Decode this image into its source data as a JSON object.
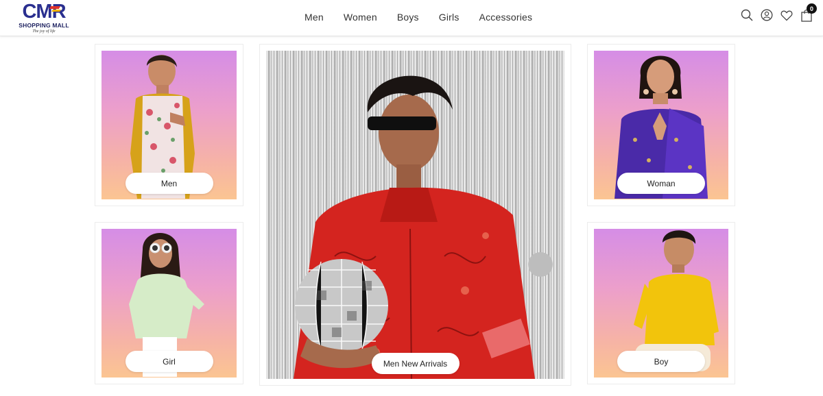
{
  "header": {
    "logo": {
      "mark": "CMR",
      "subtitle": "SHOPPING MALL",
      "tagline": "The joy of life"
    },
    "nav": [
      "Men",
      "Women",
      "Boys",
      "Girls",
      "Accessories"
    ],
    "icons": [
      "search-icon",
      "user-icon",
      "heart-icon",
      "cart-icon"
    ],
    "cart_count": "0"
  },
  "cards": {
    "men": {
      "label": "Men"
    },
    "woman": {
      "label": "Woman"
    },
    "girl": {
      "label": "Girl"
    },
    "boy": {
      "label": "Boy"
    },
    "hero": {
      "label": "Men New Arrivals"
    }
  },
  "colors": {
    "logo_blue": "#2a2f8f",
    "logo_red": "#e2342a",
    "logo_yellow": "#f4b400",
    "card_gradient_top": "#d58de6",
    "card_gradient_bottom": "#fbc592"
  }
}
